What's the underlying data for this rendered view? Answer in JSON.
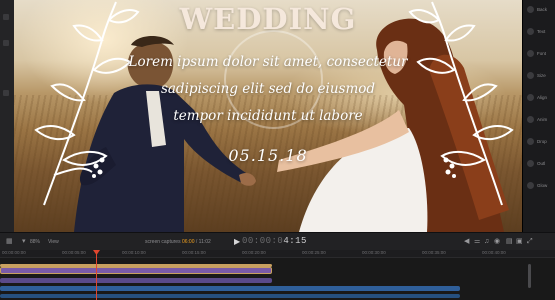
{
  "viewer": {
    "title": "WEDDING",
    "body_lines": [
      "Lorem ipsum dolor sit amet, consectetur",
      "sadipiscing elit sed do eiusmod",
      "tempor incididunt ut labore"
    ],
    "date": "05.15.18"
  },
  "inspector": {
    "labels": [
      "Back",
      "Text",
      "Font",
      "Size",
      "Align",
      "Anim",
      "Drop",
      "Outl",
      "Glow"
    ]
  },
  "toolbar": {
    "zoom_label": "88%",
    "view_label": "View",
    "title_label": "screen captures",
    "title_timecode": "06:00",
    "title_duration": "/ 11:02",
    "timecode_dim": "00:00:0",
    "timecode_bright": "4:15"
  },
  "timeline": {
    "ruler_labels": [
      "00:00:00:00",
      "00:00:05:00",
      "00:00:10:00",
      "00:00:15:00",
      "00:00:20:00",
      "00:00:25:00",
      "00:00:30:00",
      "00:00:35:00",
      "00:00:40:00"
    ]
  },
  "colors": {
    "accent_orange": "#f0a020",
    "playhead": "#e0462e",
    "title_clip": "#7a5aa8",
    "title_clip_top": "#c8a060",
    "audio_clip": "#3a6fb0"
  }
}
